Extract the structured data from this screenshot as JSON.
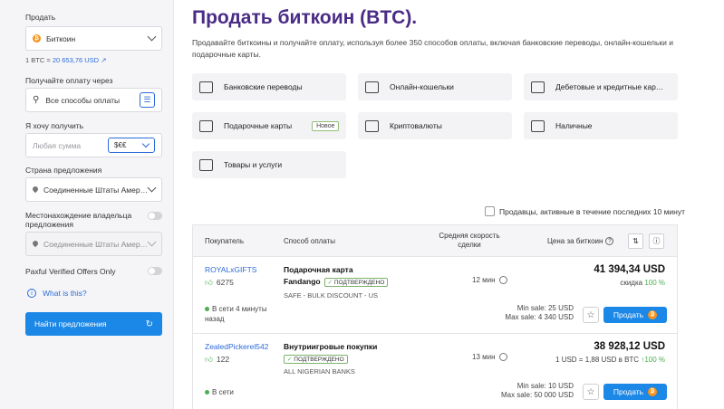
{
  "sidebar": {
    "sell_label": "Продать",
    "currency": "Биткоин",
    "rate_prefix": "1 BTC = ",
    "rate_value": "20 653,76 USD",
    "receive_via_label": "Получайте оплату через",
    "payment_placeholder": "Все способы оплаты",
    "want_label": "Я хочу получить",
    "amount_placeholder": "Любая сумма",
    "amount_currency": "$€€",
    "country_label": "Страна предложения",
    "country_value": "Соединенные Штаты Амер…",
    "owner_location_label": "Местонахождение владельца предложения",
    "owner_location_value": "Соединенные Штаты Амер…",
    "verified_offers_label": "Paxful Verified Offers Only",
    "what_is_this": "What is this?",
    "find_button": "Найти предложения"
  },
  "main": {
    "title": "Продать биткоин (BTC).",
    "description": "Продавайте биткоины и получайте оплату, используя более 350 способов оплаты, включая банковские переводы, онлайн-кошельки и подарочные карты.",
    "categories": [
      {
        "label": "Банковские переводы",
        "icon": "bank-icon"
      },
      {
        "label": "Онлайн-кошельки",
        "icon": "wallet-icon"
      },
      {
        "label": "Дебетовые и кредитные кар…",
        "icon": "credit-card-icon"
      },
      {
        "label": "Подарочные карты",
        "icon": "gift-card-icon",
        "badge": "Новое"
      },
      {
        "label": "Криптовалюты",
        "icon": "crypto-chip-icon"
      },
      {
        "label": "Наличные",
        "icon": "cash-icon"
      },
      {
        "label": "Товары и услуги",
        "icon": "shop-icon"
      }
    ],
    "active_filter_label": "Продавцы, активные в течение последних 10 минут"
  },
  "table": {
    "headers": {
      "buyer": "Покупатель",
      "method": "Способ оплаты",
      "speed": "Средняя скорость сделки",
      "price": "Цена за биткоин"
    },
    "rows": [
      {
        "user": "ROYALxGIFTS",
        "feedback": "6275",
        "status": "В сети 4 минуты назад",
        "method": "Подарочная карта",
        "sub": "Fandango",
        "verified": "ПОДТВЕРЖДЕНО",
        "tags": "SAFE - BULK DISCOUNT - US",
        "speed": "12 мин",
        "price": "41 394,34 USD",
        "discount_prefix": "скидка",
        "discount_value": "100 %",
        "min": "Min sale: 25 USD",
        "max": "Max sale: 4 340 USD",
        "sell": "Продать"
      },
      {
        "user": "ZealedPickerel542",
        "feedback": "122",
        "status": "В сети",
        "method": "Внутриигровые покупки",
        "sub": "",
        "verified": "ПОДТВЕРЖДЕНО",
        "tags": "ALL NIGERIAN BANKS",
        "speed": "13 мин",
        "price": "38 928,12 USD",
        "discount_prefix": "1 USD = 1,88 USD в BTC",
        "discount_value": "100 %",
        "min": "Min sale: 10 USD",
        "max": "Max sale: 50 000 USD",
        "sell": "Продать"
      }
    ]
  },
  "colors": {
    "title": "#4a2b86",
    "primary_button": "#1b87e6",
    "link": "#2c6bd9",
    "online": "#4caf50",
    "bitcoin": "#f7931a"
  }
}
